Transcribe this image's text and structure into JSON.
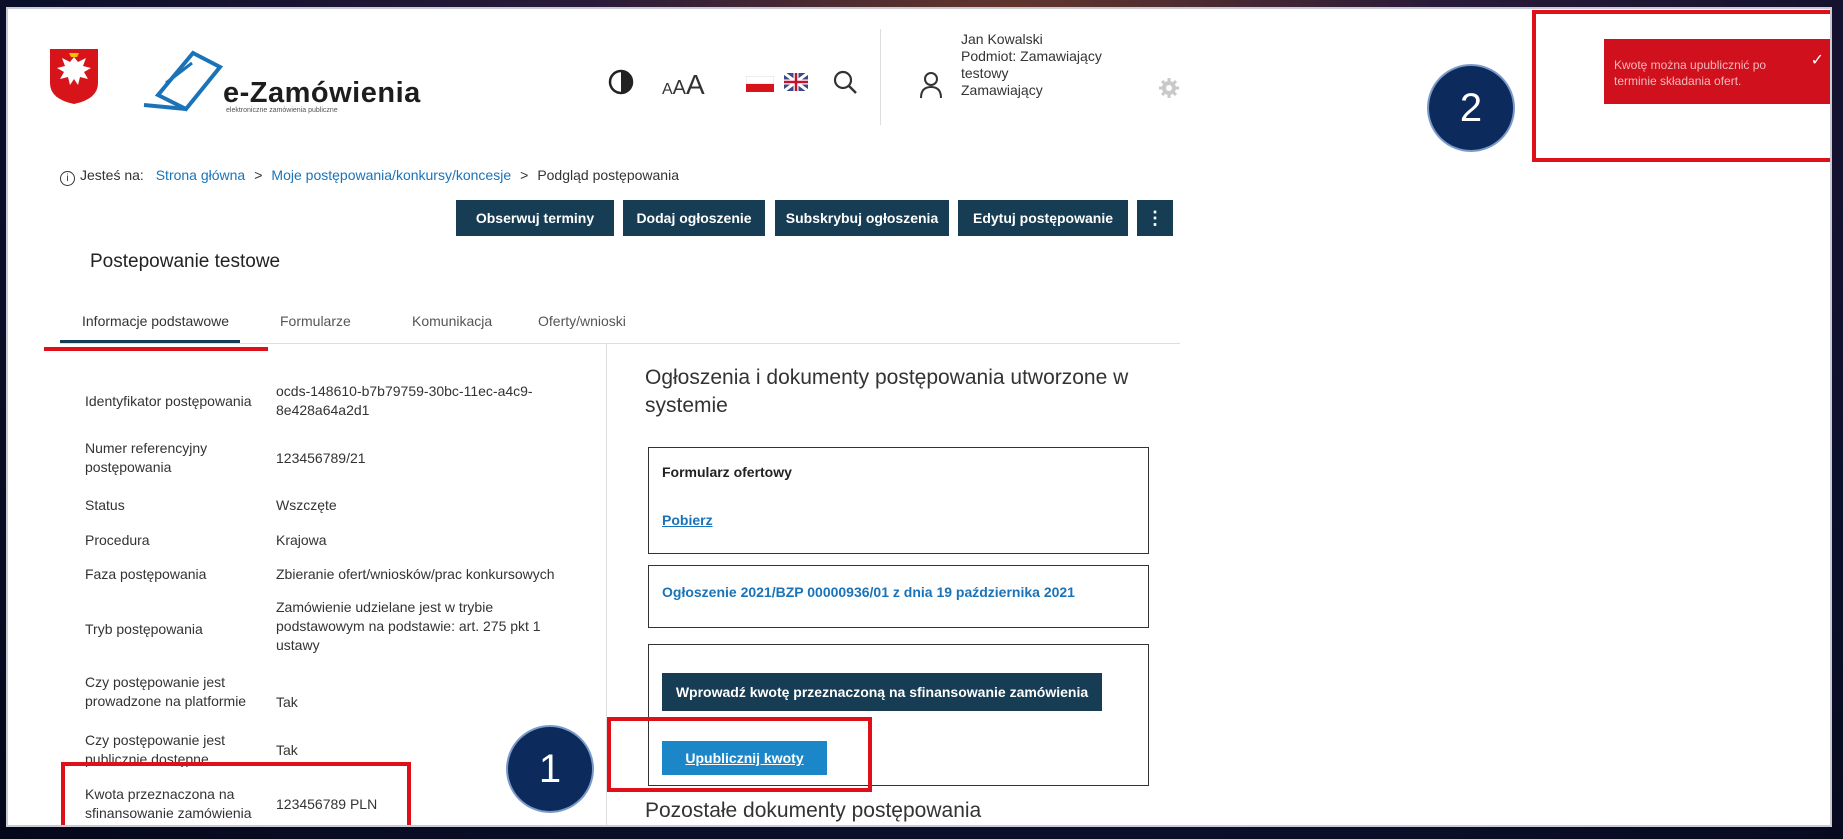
{
  "header": {
    "logo_title": "e-Zamówienia",
    "logo_subtitle": "elektroniczne zamówienia publiczne",
    "font_small_label": "A",
    "font_medium_label": "A",
    "font_large_label": "A",
    "user": {
      "name": "Jan Kowalski",
      "entity_line1": "Podmiot: Zamawiający",
      "entity_line2": "testowy",
      "role": "Zamawiający"
    }
  },
  "breadcrumb": {
    "prefix": "Jesteś na:",
    "items": [
      "Strona główna",
      "Moje postępowania/konkursy/koncesje"
    ],
    "current": "Podgląd postępowania",
    "separator": ">"
  },
  "actions": {
    "observe": "Obserwuj terminy",
    "add_notice": "Dodaj ogłoszenie",
    "subscribe": "Subskrybuj ogłoszenia",
    "edit": "Edytuj postępowanie",
    "more": "⋮"
  },
  "page_title": "Postepowanie testowe",
  "tabs": [
    "Informacje podstawowe",
    "Formularze",
    "Komunikacja",
    "Oferty/wnioski"
  ],
  "info": [
    {
      "label": "Identyfikator postępowania",
      "value": "ocds-148610-b7b79759-30bc-11ec-a4c9-8e428a64a2d1"
    },
    {
      "label": "Numer referencyjny postępowania",
      "value": "123456789/21"
    },
    {
      "label": "Status",
      "value": "Wszczęte"
    },
    {
      "label": "Procedura",
      "value": "Krajowa"
    },
    {
      "label": "Faza postępowania",
      "value": "Zbieranie ofert/wniosków/prac konkursowych"
    },
    {
      "label": "Tryb postępowania",
      "value": "Zamówienie udzielane jest w trybie podstawowym na podstawie: art. 275 pkt 1 ustawy"
    },
    {
      "label": "Czy postępowanie jest prowadzone na platformie",
      "value": "Tak"
    },
    {
      "label": "Czy postępowanie jest publicznie dostępne",
      "value": "Tak"
    },
    {
      "label": "Kwota przeznaczona na sfinansowanie zamówienia",
      "value": "123456789 PLN"
    }
  ],
  "right": {
    "heading": "Ogłoszenia i dokumenty postępowania utworzone w systemie",
    "form_box": {
      "title": "Formularz ofertowy",
      "link": "Pobierz"
    },
    "notice_box": {
      "title": "Ogłoszenie 2021/BZP 00000936/01 z dnia 19 października 2021"
    },
    "amount_box": {
      "enter_button": "Wprowadź kwotę przeznaczoną na sfinansowanie zamówienia",
      "publish_button": "Upublicznij kwoty"
    },
    "other_heading": "Pozostałe dokumenty postępowania"
  },
  "toast": {
    "message": "Kwotę można upublicznić po terminie składania ofert."
  },
  "callouts": {
    "one": "1",
    "two": "2"
  },
  "colors": {
    "accent_dark": "#173d54",
    "link": "#1a73b8",
    "button_blue": "#1b86c8",
    "alert_red": "#d0101d",
    "highlight_red": "#e0101a"
  }
}
